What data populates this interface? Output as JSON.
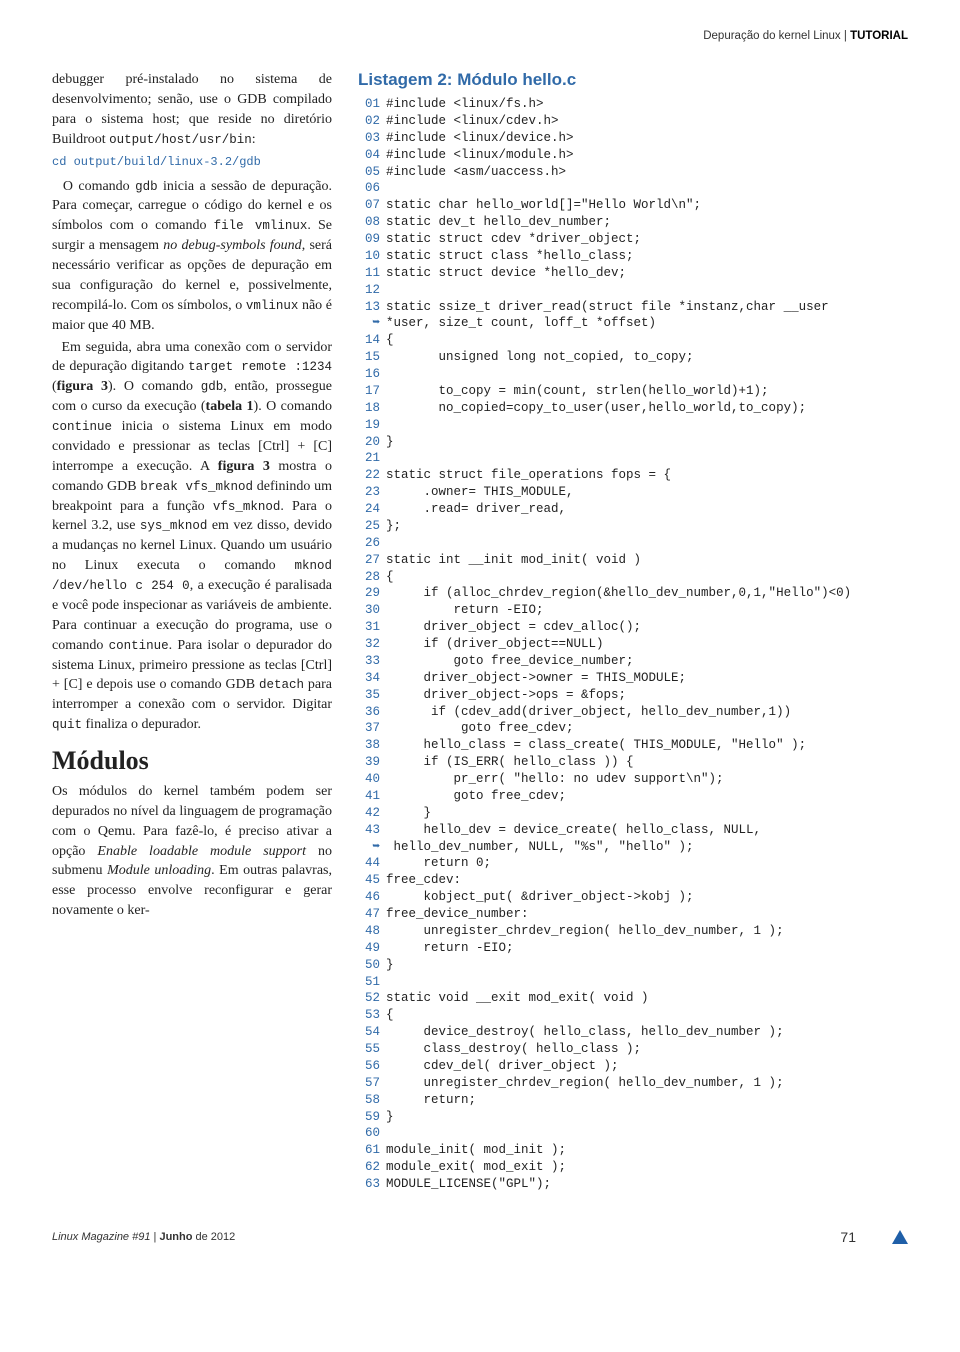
{
  "header": {
    "category": "Depuração do kernel Linux",
    "section": "TUTORIAL"
  },
  "left": {
    "p1a": "debugger pré-instalado no sistema de desenvolvimento; senão, use o GDB compilado para o sistema host; que reside no diretório Buildroot ",
    "p1b": "output/host/usr/bin",
    "p1c": ":",
    "cmd1": "cd output/build/linux-3.2/gdb",
    "p2a": "O comando ",
    "p2b": "gdb",
    "p2c": " inicia a sessão de depuração. Para começar, carregue o código do kernel e os símbolos com o comando ",
    "p2d": "file vmlinux",
    "p2e": ". Se surgir a mensagem ",
    "p2f": "no debug-symbols found",
    "p2g": ", será necessário verificar as opções de depuração em sua configuração do kernel e, possivelmente, recompilá-lo. Com os símbolos, o ",
    "p2h": "vmlinux",
    "p2i": " não é maior que 40 MB.",
    "p3a": "Em seguida, abra uma conexão com o servidor de depuração digitando ",
    "p3b": "target remote :1234",
    "p3c": " (",
    "p3d": "figura 3",
    "p3e": "). O comando ",
    "p3f": "gdb",
    "p3g": ", então, prossegue com o curso da execução (",
    "p3h": "tabela 1",
    "p3i": "). O comando ",
    "p3j": "continue",
    "p3k": " inicia o sistema Linux em modo convidado e pressionar as teclas [Ctrl] + [C] interrompe a execução. A ",
    "p3l": "figura 3",
    "p3m": " mostra o comando GDB ",
    "p3n": "break vfs_mknod",
    "p3o": " definindo um breakpoint para a função ",
    "p3p": "vfs_mknod",
    "p3q": ". Para o kernel 3.2, use ",
    "p3r": "sys_mknod",
    "p3s": " em vez disso, devido a mudanças no kernel Linux. Quando um usuário no Linux executa o comando ",
    "p3t": "mknod /dev/hello c 254 0",
    "p3u": ", a execução é paralisada e você pode inspecionar as variáveis de ambiente. Para continuar a execução do programa, use o comando ",
    "p3v": "continue",
    "p3w": ". Para isolar o depurador do sistema Linux, primeiro pressione as teclas [Ctrl] + [C] e depois use o comando GDB ",
    "p3x": "detach",
    "p3y": " para interromper a conexão com o servidor. Digitar ",
    "p3z": "quit",
    "p3za": " finaliza o depurador.",
    "h2": "Módulos",
    "p4a": "Os módulos do kernel também podem ser depurados no nível da linguagem de programação com o Qemu. Para fazê-lo, é preciso ativar a opção ",
    "p4b": "Enable loadable module support",
    "p4c": " no submenu ",
    "p4d": "Module unloading",
    "p4e": ". Em outras palavras, esse processo envolve reconfigurar e gerar novamente o ker-"
  },
  "listing": {
    "title": "Listagem 2: Módulo hello.c",
    "lines": [
      {
        "n": "01",
        "t": "#include <linux/fs.h>"
      },
      {
        "n": "02",
        "t": "#include <linux/cdev.h>"
      },
      {
        "n": "03",
        "t": "#include <linux/device.h>"
      },
      {
        "n": "04",
        "t": "#include <linux/module.h>"
      },
      {
        "n": "05",
        "t": "#include <asm/uaccess.h>"
      },
      {
        "n": "06",
        "t": ""
      },
      {
        "n": "07",
        "t": "static char hello_world[]=\"Hello World\\n\";"
      },
      {
        "n": "08",
        "t": "static dev_t hello_dev_number;"
      },
      {
        "n": "09",
        "t": "static struct cdev *driver_object;"
      },
      {
        "n": "10",
        "t": "static struct class *hello_class;"
      },
      {
        "n": "11",
        "t": "static struct device *hello_dev;"
      },
      {
        "n": "12",
        "t": ""
      },
      {
        "n": "13",
        "t": "static ssize_t driver_read(struct file *instanz,char __user"
      },
      {
        "n": "➥",
        "t": "*user, size_t count, loff_t *offset)"
      },
      {
        "n": "14",
        "t": "{"
      },
      {
        "n": "15",
        "t": "       unsigned long not_copied, to_copy;"
      },
      {
        "n": "16",
        "t": ""
      },
      {
        "n": "17",
        "t": "       to_copy = min(count, strlen(hello_world)+1);"
      },
      {
        "n": "18",
        "t": "       no_copied=copy_to_user(user,hello_world,to_copy);"
      },
      {
        "n": "19",
        "t": ""
      },
      {
        "n": "20",
        "t": "}"
      },
      {
        "n": "21",
        "t": ""
      },
      {
        "n": "22",
        "t": "static struct file_operations fops = {"
      },
      {
        "n": "23",
        "t": "     .owner= THIS_MODULE,"
      },
      {
        "n": "24",
        "t": "     .read= driver_read,"
      },
      {
        "n": "25",
        "t": "};"
      },
      {
        "n": "26",
        "t": ""
      },
      {
        "n": "27",
        "t": "static int __init mod_init( void )"
      },
      {
        "n": "28",
        "t": "{"
      },
      {
        "n": "29",
        "t": "     if (alloc_chrdev_region(&hello_dev_number,0,1,\"Hello\")&lt;0)"
      },
      {
        "n": "30",
        "t": "         return -EIO;"
      },
      {
        "n": "31",
        "t": "     driver_object = cdev_alloc();"
      },
      {
        "n": "32",
        "t": "     if (driver_object==NULL)"
      },
      {
        "n": "33",
        "t": "         goto free_device_number;"
      },
      {
        "n": "34",
        "t": "     driver_object->owner = THIS_MODULE;"
      },
      {
        "n": "35",
        "t": "     driver_object&#8208;>ops = &fops;"
      },
      {
        "n": "36",
        "t": "      if (cdev_add(driver_object, hello_dev_number,1))"
      },
      {
        "n": "37",
        "t": "          goto free_cdev;"
      },
      {
        "n": "38",
        "t": "     hello_class = class_create( THIS_MODULE, \"Hello\" );"
      },
      {
        "n": "39",
        "t": "     if (IS_ERR( hello_class )) {"
      },
      {
        "n": "40",
        "t": "         pr_err( \"hello: no udev support\\n\");"
      },
      {
        "n": "41",
        "t": "         goto free_cdev;"
      },
      {
        "n": "42",
        "t": "     }"
      },
      {
        "n": "43",
        "t": "     hello_dev = device_create( hello_class, NULL,"
      },
      {
        "n": "➥",
        "t": " hello_dev_number, NULL, \"%s\", \"hello\" );"
      },
      {
        "n": "44",
        "t": "     return 0;"
      },
      {
        "n": "45",
        "t": "free_cdev:"
      },
      {
        "n": "46",
        "t": "     kobject_put( &driver_object&#8208;>kobj );"
      },
      {
        "n": "47",
        "t": "free_device_number:"
      },
      {
        "n": "48",
        "t": "     unregister_chrdev_region( hello_dev_number, 1 );"
      },
      {
        "n": "49",
        "t": "     return -EIO;"
      },
      {
        "n": "50",
        "t": "}"
      },
      {
        "n": "51",
        "t": ""
      },
      {
        "n": "52",
        "t": "static void __exit mod_exit( void )"
      },
      {
        "n": "53",
        "t": "{"
      },
      {
        "n": "54",
        "t": "     device_destroy( hello_class, hello_dev_number );"
      },
      {
        "n": "55",
        "t": "     class_destroy( hello_class );"
      },
      {
        "n": "56",
        "t": "     cdev_del( driver_object );"
      },
      {
        "n": "57",
        "t": "     unregister_chrdev_region( hello_dev_number, 1 );"
      },
      {
        "n": "58",
        "t": "     return;"
      },
      {
        "n": "59",
        "t": "}"
      },
      {
        "n": "60",
        "t": ""
      },
      {
        "n": "61",
        "t": "module_init( mod_init );"
      },
      {
        "n": "62",
        "t": "module_exit( mod_exit );"
      },
      {
        "n": "63",
        "t": "MODULE_LICENSE(\"GPL\");"
      }
    ]
  },
  "footer": {
    "left_a": "Linux Magazine #91",
    "left_b": " | ",
    "left_c": "Junho",
    "left_d": " de 2012",
    "page": "71"
  }
}
